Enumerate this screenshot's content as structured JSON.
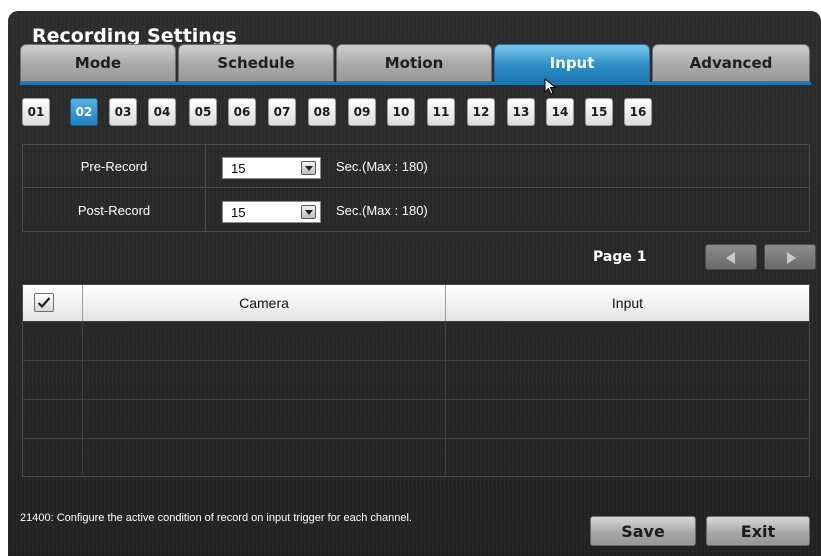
{
  "window": {
    "title": "Recording Settings"
  },
  "tabs": [
    {
      "label": "Mode",
      "active": false
    },
    {
      "label": "Schedule",
      "active": false
    },
    {
      "label": "Motion",
      "active": false
    },
    {
      "label": "Input",
      "active": true
    },
    {
      "label": "Advanced",
      "active": false
    }
  ],
  "channels": {
    "items": [
      "01",
      "02",
      "03",
      "04",
      "05",
      "06",
      "07",
      "08",
      "09",
      "10",
      "11",
      "12",
      "13",
      "14",
      "15",
      "16"
    ],
    "selected": "02"
  },
  "settings": {
    "pre_record": {
      "label": "Pre-Record",
      "value": "15",
      "unit": "Sec.(Max : 180)"
    },
    "post_record": {
      "label": "Post-Record",
      "value": "15",
      "unit": "Sec.(Max : 180)"
    }
  },
  "pagination": {
    "label": "Page 1"
  },
  "table": {
    "headers": {
      "camera": "Camera",
      "input": "Input"
    },
    "rows": [
      {
        "camera": "",
        "input": ""
      },
      {
        "camera": "",
        "input": ""
      },
      {
        "camera": "",
        "input": ""
      },
      {
        "camera": "",
        "input": ""
      }
    ]
  },
  "footer": {
    "status": "21400: Configure the active condition of record on input trigger for each channel.",
    "save_label": "Save",
    "exit_label": "Exit"
  },
  "colors": {
    "accent": "#1f80c0",
    "background": "#2a2a2a",
    "tab_inactive": "#a9a9a9"
  },
  "icons": {
    "select_arrow": "chevron-down-icon",
    "prev": "triangle-left-icon",
    "next": "triangle-right-icon",
    "check": "checkmark-icon",
    "cursor": "mouse-pointer-icon"
  }
}
